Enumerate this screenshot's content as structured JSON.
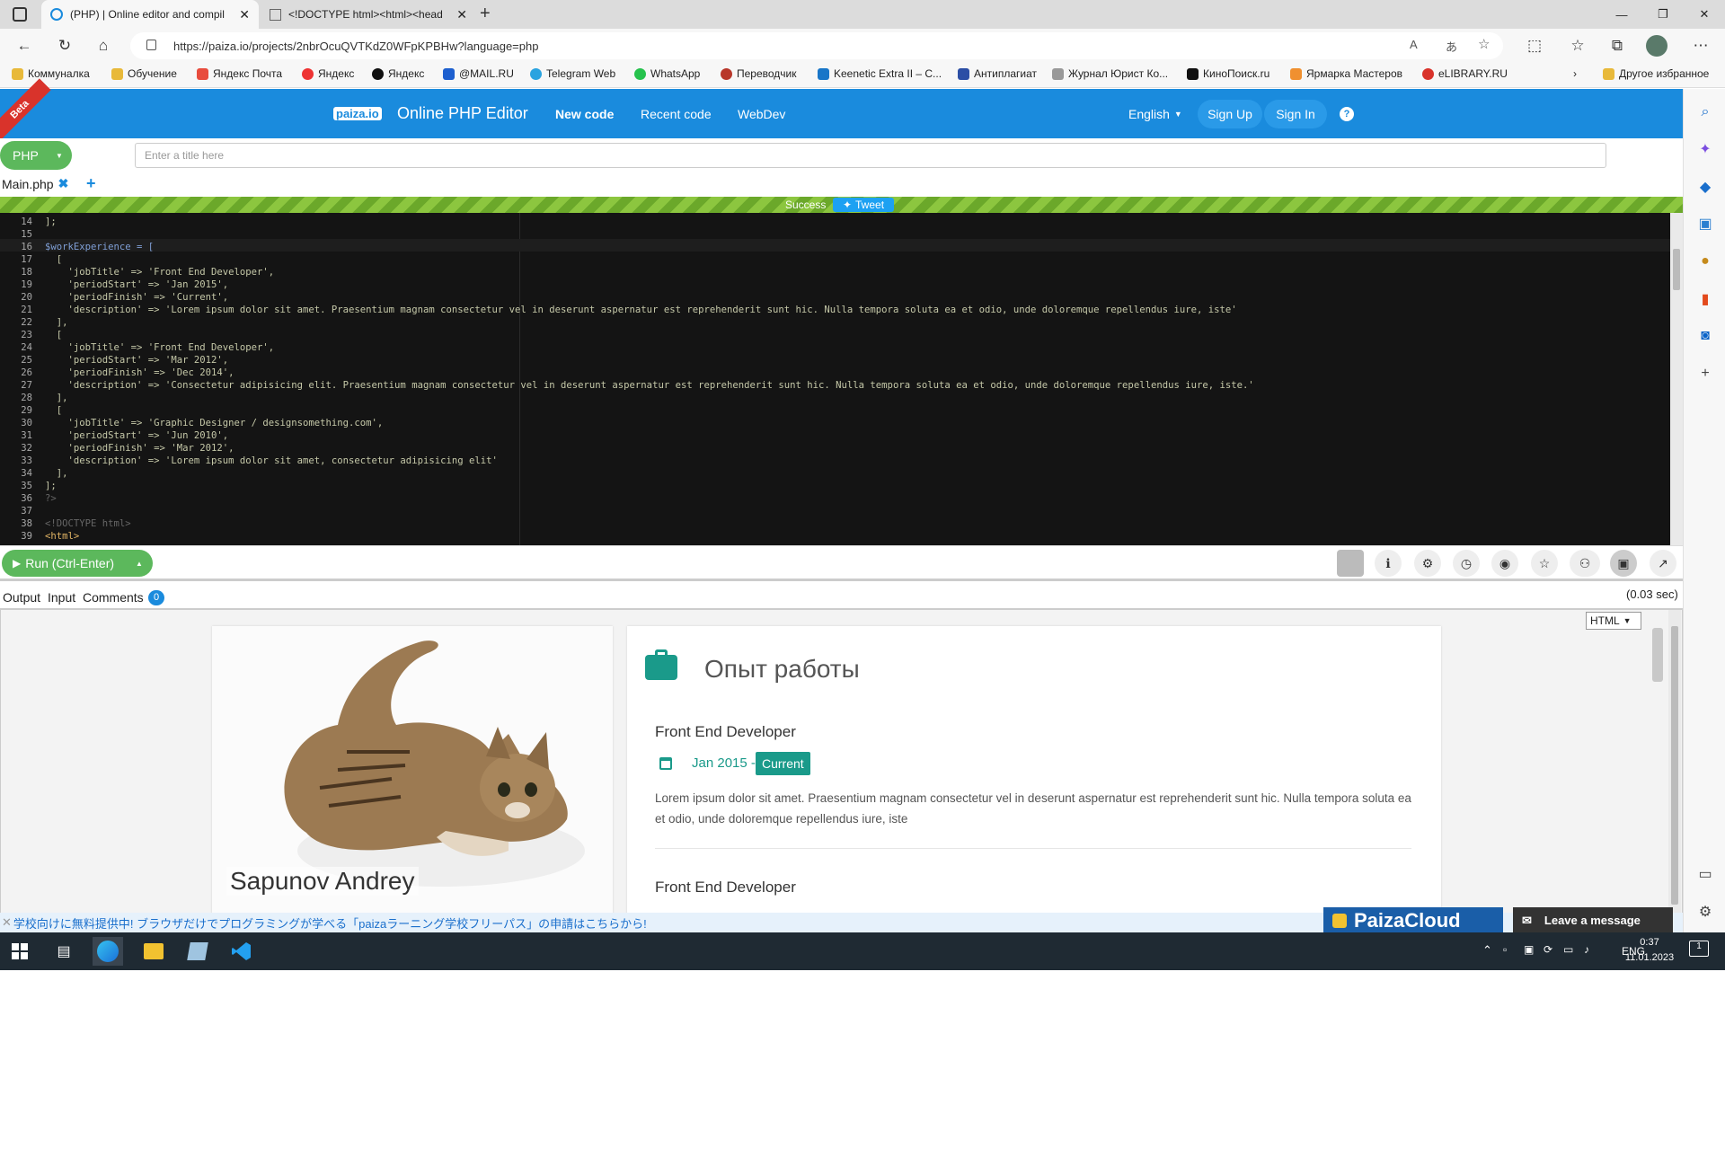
{
  "browser": {
    "tabs": [
      {
        "title": "(PHP) | Online editor and compil",
        "active": true
      },
      {
        "title": "<!DOCTYPE html><html><head",
        "active": false
      }
    ],
    "url": "https://paiza.io/projects/2nbrOcuQVTKdZ0WFpKPBHw?language=php",
    "bookmarks": [
      {
        "label": "Коммуналка",
        "icon": "folder-icon"
      },
      {
        "label": "Обучение",
        "icon": "folder-icon"
      },
      {
        "label": "Яндекс Почта",
        "icon": "mail-icon"
      },
      {
        "label": "Яндекс",
        "icon": "yandex-icon"
      },
      {
        "label": "Яндекс",
        "icon": "yandex-dark-icon"
      },
      {
        "label": "@MAIL.RU",
        "icon": "mailru-icon"
      },
      {
        "label": "Telegram Web",
        "icon": "telegram-icon"
      },
      {
        "label": "WhatsApp",
        "icon": "whatsapp-icon"
      },
      {
        "label": "Переводчик",
        "icon": "translate-icon"
      },
      {
        "label": "Keenetic Extra II – C...",
        "icon": "keenetic-icon"
      },
      {
        "label": "Антиплагиат",
        "icon": "shield-icon"
      },
      {
        "label": "Журнал Юрист Ко...",
        "icon": "journal-icon"
      },
      {
        "label": "КиноПоиск.ru",
        "icon": "kinopoisk-icon"
      },
      {
        "label": "Ярмарка Мастеров",
        "icon": "fair-icon"
      },
      {
        "label": "eLIBRARY.RU",
        "icon": "elibrary-icon"
      }
    ],
    "other_bookmarks": "Другое избранное"
  },
  "paiza": {
    "beta": "Beta",
    "logo": "paiza.io",
    "title": "Online PHP Editor",
    "nav": [
      "New code",
      "Recent code",
      "WebDev"
    ],
    "language_menu": "English",
    "signup": "Sign Up",
    "signin": "Sign In",
    "help": "?",
    "lang_button": "PHP",
    "title_placeholder": "Enter a title here",
    "file_tab": "Main.php",
    "status": "Success",
    "tweet": "Tweet",
    "run_button": "Run (Ctrl-Enter)",
    "output_tabs": [
      "Output",
      "Input",
      "Comments"
    ],
    "comments_count": "0",
    "exec_time": "(0.03 sec)",
    "output_format": "HTML",
    "bottom_banner": "学校向けに無料提供中! ブラウザだけでプログラミングが学べる「paizaラーニング学校フリーパス」の申請はこちらから!",
    "cloud": "PaizaCloud",
    "leave_message": "Leave a message"
  },
  "code": [
    {
      "n": "14",
      "t": "];"
    },
    {
      "n": "15",
      "t": ""
    },
    {
      "n": "16",
      "t": "$workExperience = ["
    },
    {
      "n": "17",
      "t": "  ["
    },
    {
      "n": "18",
      "t": "    'jobTitle' => 'Front End Developer',"
    },
    {
      "n": "19",
      "t": "    'periodStart' => 'Jan 2015',"
    },
    {
      "n": "20",
      "t": "    'periodFinish' => 'Current',"
    },
    {
      "n": "21",
      "t": "    'description' => 'Lorem ipsum dolor sit amet. Praesentium magnam consectetur vel in deserunt aspernatur est reprehenderit sunt hic. Nulla tempora soluta ea et odio, unde doloremque repellendus iure, iste'"
    },
    {
      "n": "22",
      "t": "  ],"
    },
    {
      "n": "23",
      "t": "  ["
    },
    {
      "n": "24",
      "t": "    'jobTitle' => 'Front End Developer',"
    },
    {
      "n": "25",
      "t": "    'periodStart' => 'Mar 2012',"
    },
    {
      "n": "26",
      "t": "    'periodFinish' => 'Dec 2014',"
    },
    {
      "n": "27",
      "t": "    'description' => 'Consectetur adipisicing elit. Praesentium magnam consectetur vel in deserunt aspernatur est reprehenderit sunt hic. Nulla tempora soluta ea et odio, unde doloremque repellendus iure, iste.'"
    },
    {
      "n": "28",
      "t": "  ],"
    },
    {
      "n": "29",
      "t": "  ["
    },
    {
      "n": "30",
      "t": "    'jobTitle' => 'Graphic Designer / designsomething.com',"
    },
    {
      "n": "31",
      "t": "    'periodStart' => 'Jun 2010',"
    },
    {
      "n": "32",
      "t": "    'periodFinish' => 'Mar 2012',"
    },
    {
      "n": "33",
      "t": "    'description' => 'Lorem ipsum dolor sit amet, consectetur adipisicing elit'"
    },
    {
      "n": "34",
      "t": "  ],"
    },
    {
      "n": "35",
      "t": "];"
    },
    {
      "n": "36",
      "t": "?>"
    },
    {
      "n": "37",
      "t": ""
    },
    {
      "n": "38",
      "t": "<!DOCTYPE html>"
    },
    {
      "n": "39",
      "t": "<html>"
    }
  ],
  "output": {
    "name": "Sapunov Andrey",
    "section_title": "Опыт работы",
    "jobs": [
      {
        "title": "Front End Developer",
        "start": "Jan 2015 -",
        "finish": "Current",
        "description": "Lorem ipsum dolor sit amet. Praesentium magnam consectetur vel in deserunt aspernatur est reprehenderit sunt hic. Nulla tempora soluta ea et odio, unde doloremque repellendus iure, iste"
      },
      {
        "title": "Front End Developer"
      }
    ],
    "accent": "#1a9a8a"
  },
  "taskbar": {
    "lang": "ENG",
    "time": "0:37",
    "date": "11.01.2023",
    "notifications": "1"
  }
}
